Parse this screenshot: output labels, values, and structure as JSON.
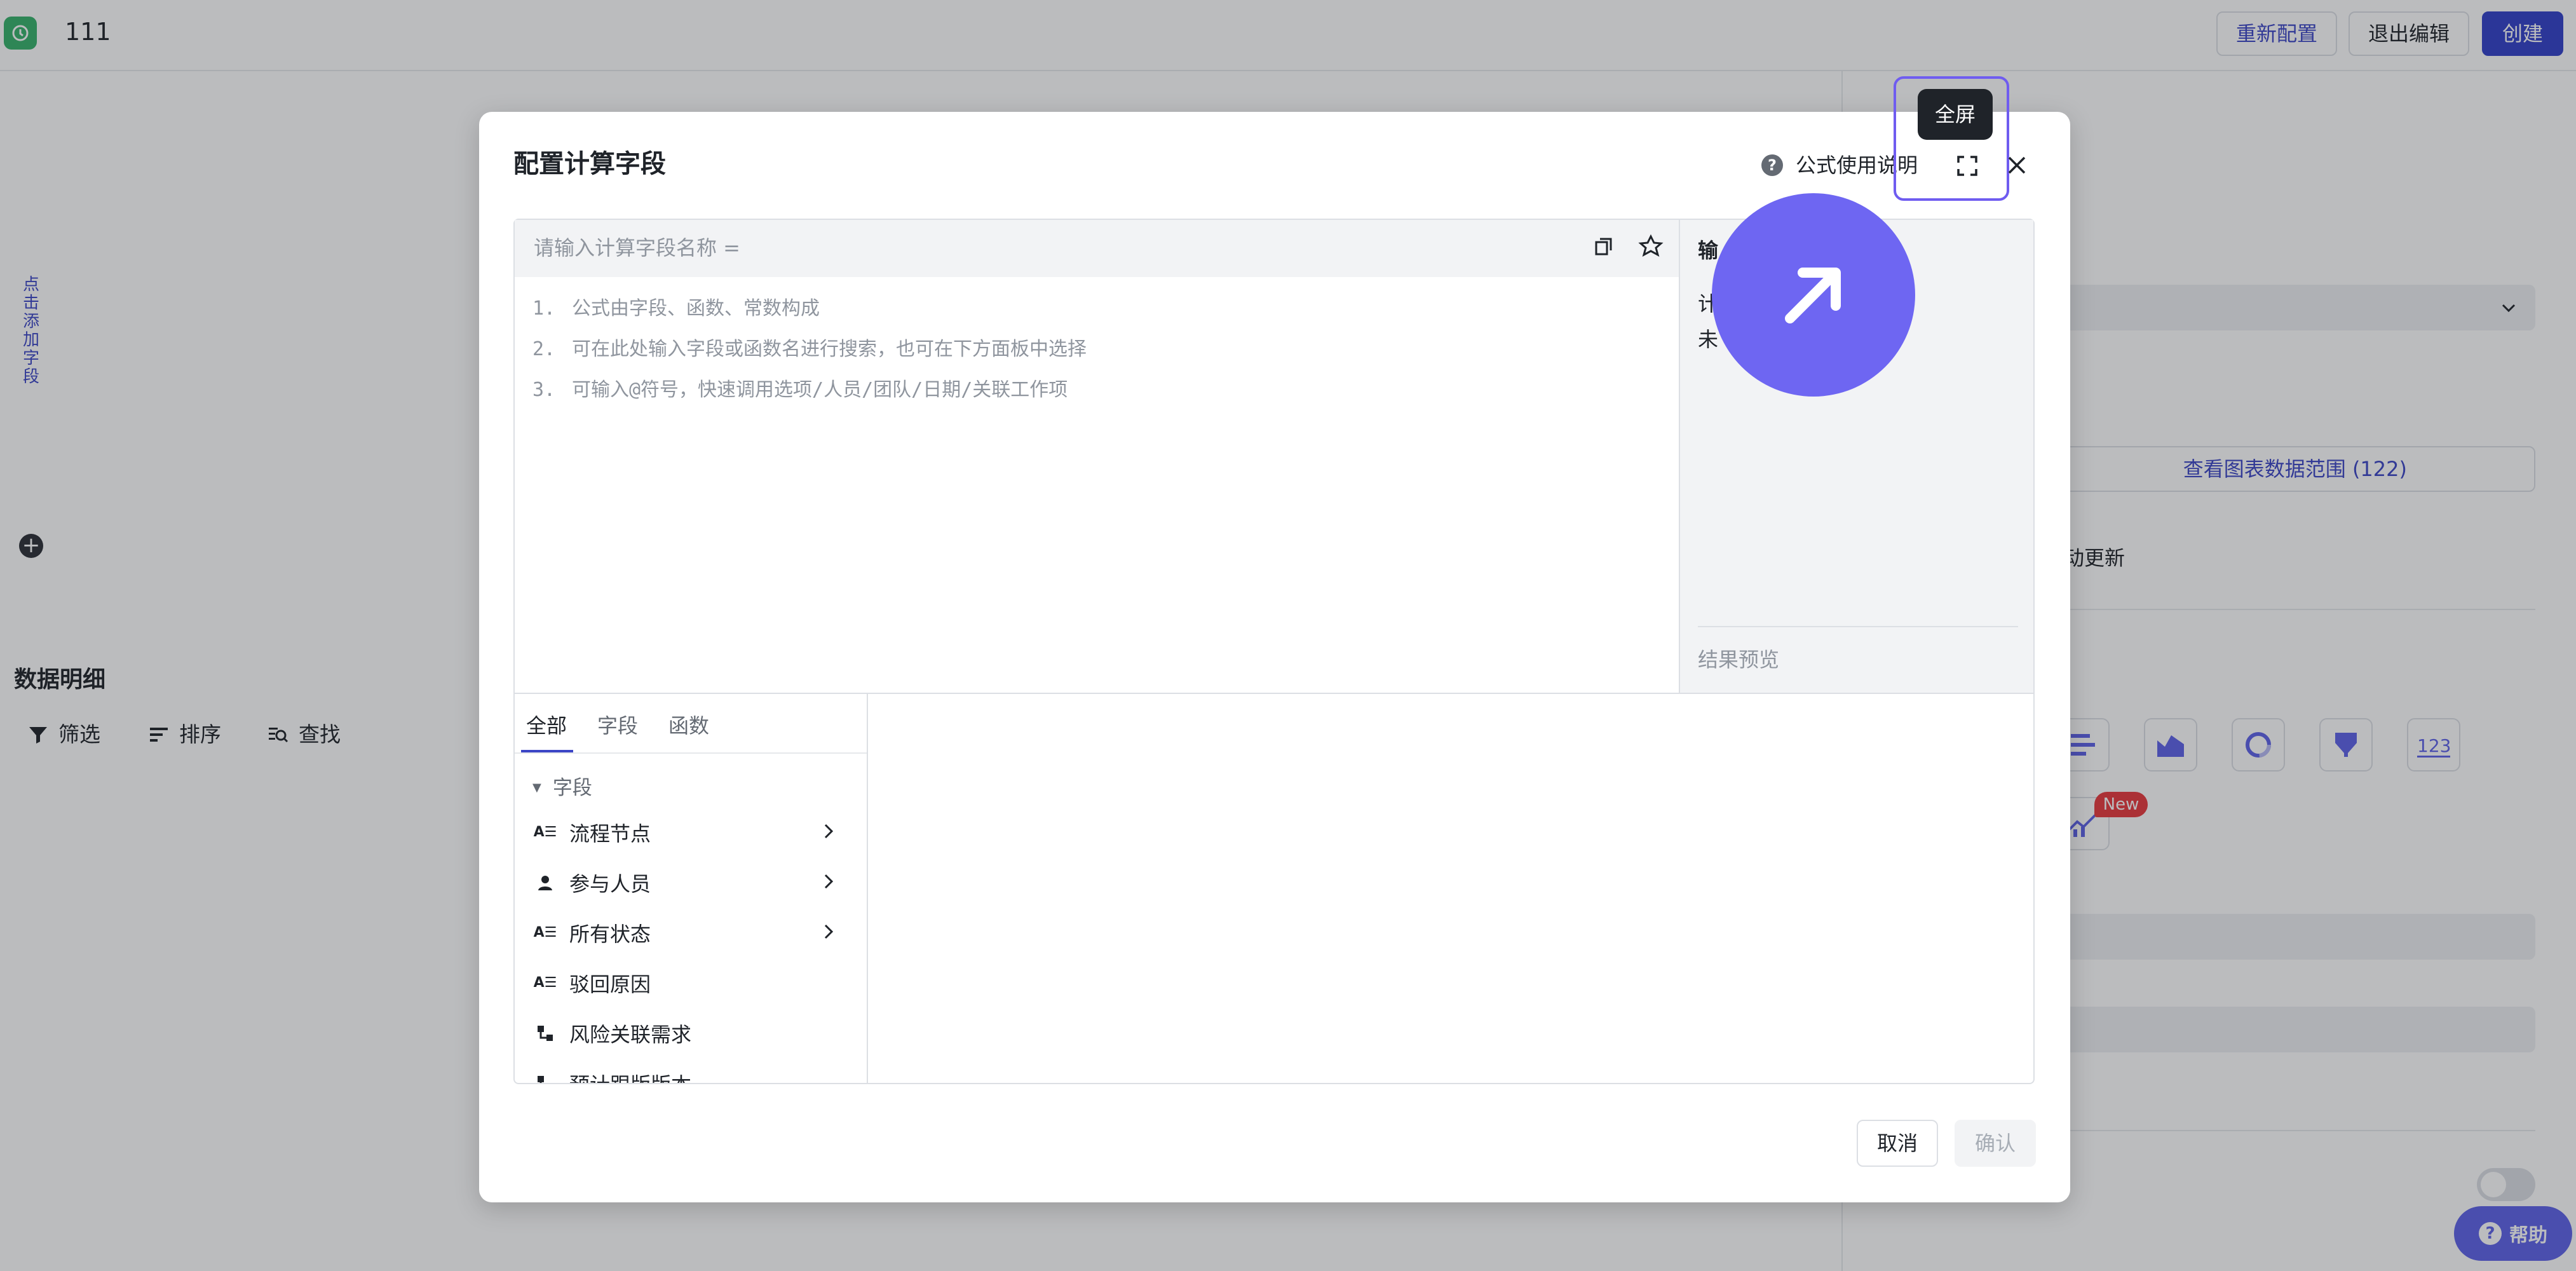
{
  "app": {
    "title": "111"
  },
  "toolbar": {
    "reconfigure": "重新配置",
    "exit_edit": "退出编辑",
    "create": "创建"
  },
  "left": {
    "add_field_vertical": "点击添加字段",
    "section_title": "数据明细",
    "tools": {
      "filter": "筛选",
      "sort": "排序",
      "find": "查找"
    }
  },
  "right_panel": {
    "view_range": "查看图表数据范围 (122)",
    "auto_update_partial": "动更新",
    "new_badge": "New"
  },
  "help": {
    "label": "帮助"
  },
  "modal": {
    "title": "配置计算字段",
    "help_link": "公式使用说明",
    "fullscreen_tooltip": "全屏",
    "name_placeholder": "请输入计算字段名称 =",
    "hints": [
      {
        "num": "1.",
        "text": "公式由字段、函数、常数构成"
      },
      {
        "num": "2.",
        "text": "可在此处输入字段或函数名进行搜索，也可在下方面板中选择"
      },
      {
        "num": "3.",
        "text": "可输入@符号，快速调用选项/人员/团队/日期/关联工作项"
      }
    ],
    "output": {
      "title": "输",
      "line1": "计",
      "line2": "未",
      "preview": "结果预览"
    },
    "tabs": [
      "全部",
      "字段",
      "函数"
    ],
    "group_label": "字段",
    "fields": [
      {
        "name": "流程节点",
        "icon": "text-icon",
        "expandable": true
      },
      {
        "name": "参与人员",
        "icon": "person-icon",
        "expandable": true
      },
      {
        "name": "所有状态",
        "icon": "text-icon",
        "expandable": true
      },
      {
        "name": "驳回原因",
        "icon": "text-icon",
        "expandable": false
      },
      {
        "name": "风险关联需求",
        "icon": "relation-icon",
        "expandable": false
      },
      {
        "name": "预计跟版版本",
        "icon": "relation-icon",
        "expandable": false
      }
    ],
    "cancel": "取消",
    "confirm": "确认"
  }
}
